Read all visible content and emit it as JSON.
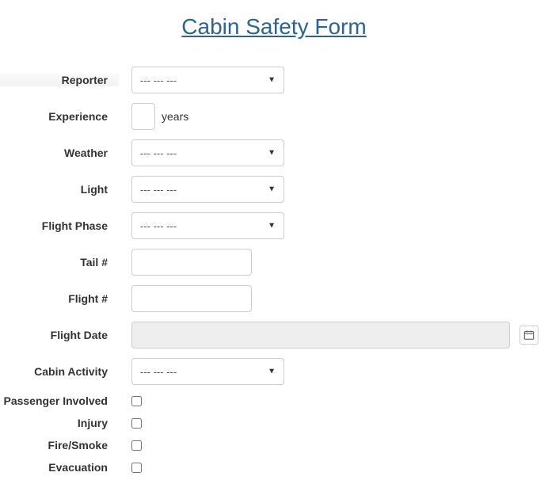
{
  "title": "Cabin Safety Form",
  "placeholder_dashes": "--- --- ---",
  "fields": {
    "reporter": {
      "label": "Reporter",
      "value": "--- --- ---"
    },
    "experience": {
      "label": "Experience",
      "value": "",
      "suffix": "years"
    },
    "weather": {
      "label": "Weather",
      "value": "--- --- ---"
    },
    "light": {
      "label": "Light",
      "value": "--- --- ---"
    },
    "flight_phase": {
      "label": "Flight Phase",
      "value": "--- --- ---"
    },
    "tail_number": {
      "label": "Tail #",
      "value": ""
    },
    "flight_number": {
      "label": "Flight #",
      "value": ""
    },
    "flight_date": {
      "label": "Flight Date",
      "value": ""
    },
    "cabin_activity": {
      "label": "Cabin Activity",
      "value": "--- --- ---"
    },
    "passenger_involved": {
      "label": "Passenger Involved",
      "checked": false
    },
    "injury": {
      "label": "Injury",
      "checked": false
    },
    "fire_smoke": {
      "label": "Fire/Smoke",
      "checked": false
    },
    "evacuation": {
      "label": "Evacuation",
      "checked": false
    }
  }
}
